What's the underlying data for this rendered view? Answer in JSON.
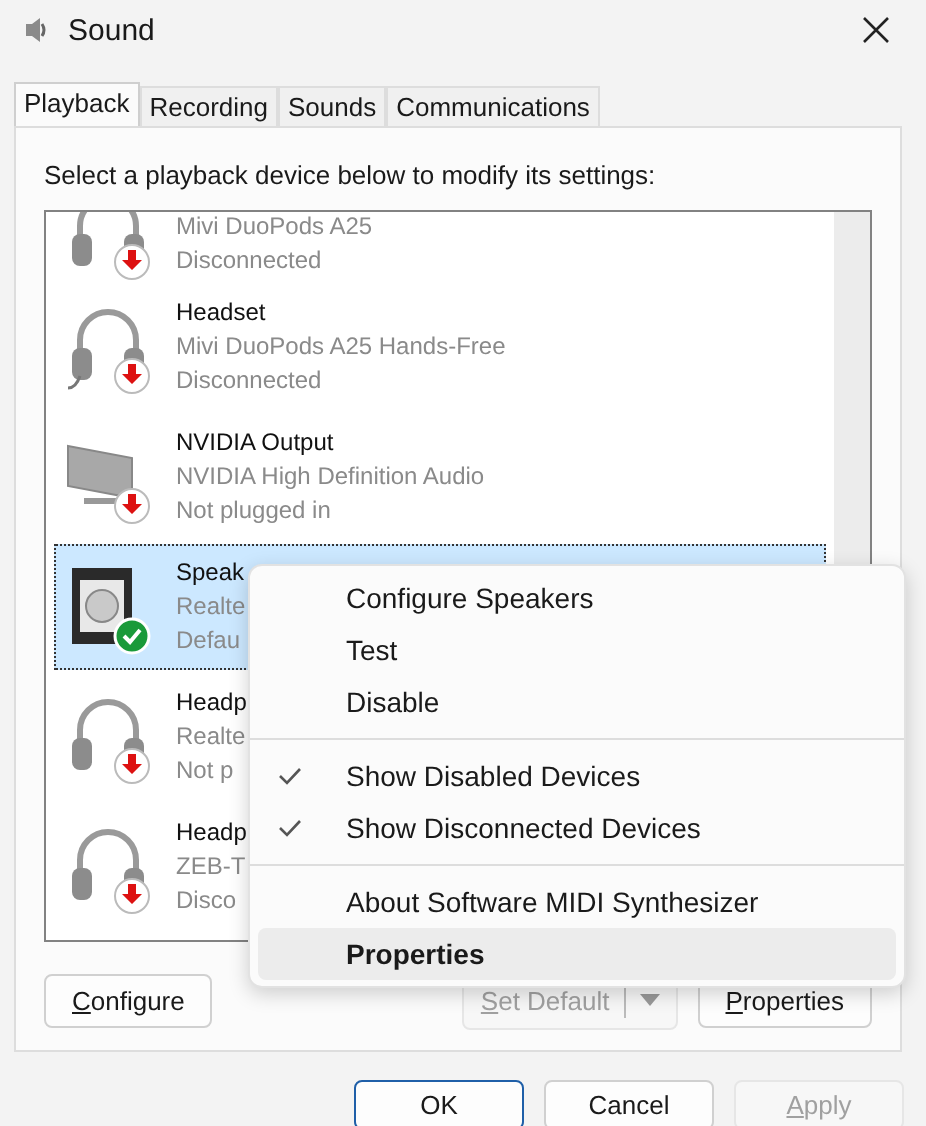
{
  "window": {
    "title": "Sound"
  },
  "tabs": [
    {
      "label": "Playback",
      "selected": true
    },
    {
      "label": "Recording",
      "selected": false
    },
    {
      "label": "Sounds",
      "selected": false
    },
    {
      "label": "Communications",
      "selected": false
    }
  ],
  "instruction": "Select a playback device below to modify its settings:",
  "devices": [
    {
      "kind": "headphones",
      "description": "Mivi DuoPods A25",
      "status": "Disconnected",
      "default": false,
      "selected": false
    },
    {
      "kind": "headset",
      "name": "Headset",
      "description": "Mivi DuoPods A25 Hands-Free",
      "status": "Disconnected",
      "default": false,
      "selected": false
    },
    {
      "kind": "monitor",
      "name": "NVIDIA Output",
      "description": "NVIDIA High Definition Audio",
      "status": "Not plugged in",
      "default": false,
      "selected": false
    },
    {
      "kind": "speaker",
      "name": "Speak",
      "description": "Realte",
      "status": "Defau",
      "default": true,
      "selected": true
    },
    {
      "kind": "headphones",
      "name": "Headp",
      "description": "Realte",
      "status": "Not p",
      "default": false,
      "selected": false
    },
    {
      "kind": "headphones",
      "name": "Headp",
      "description": "ZEB-T",
      "status": "Disco",
      "default": false,
      "selected": false
    }
  ],
  "context_menu": [
    {
      "kind": "item",
      "label": "Configure Speakers",
      "checked": false,
      "selected": false,
      "default": false
    },
    {
      "kind": "item",
      "label": "Test",
      "checked": false,
      "selected": false,
      "default": false
    },
    {
      "kind": "item",
      "label": "Disable",
      "checked": false,
      "selected": false,
      "default": false
    },
    {
      "kind": "separator"
    },
    {
      "kind": "item",
      "label": "Show Disabled Devices",
      "checked": true,
      "selected": false,
      "default": false
    },
    {
      "kind": "item",
      "label": "Show Disconnected Devices",
      "checked": true,
      "selected": false,
      "default": false
    },
    {
      "kind": "separator"
    },
    {
      "kind": "item",
      "label": "About Software MIDI Synthesizer",
      "checked": false,
      "selected": false,
      "default": false
    },
    {
      "kind": "item",
      "label": "Properties",
      "checked": false,
      "selected": true,
      "default": true
    }
  ],
  "panel_buttons": {
    "configure": {
      "label": "Configure",
      "access_key": true,
      "disabled": false
    },
    "set_default": {
      "label": "Set Default",
      "access_key": true,
      "disabled": true
    },
    "properties": {
      "label": "Properties",
      "access_key": true,
      "disabled": false
    }
  },
  "dialog_buttons": [
    {
      "label": "OK",
      "access_key": false,
      "disabled": false,
      "default": true
    },
    {
      "label": "Cancel",
      "access_key": false,
      "disabled": false,
      "default": false
    },
    {
      "label": "Apply",
      "access_key": true,
      "disabled": true,
      "default": false
    }
  ]
}
